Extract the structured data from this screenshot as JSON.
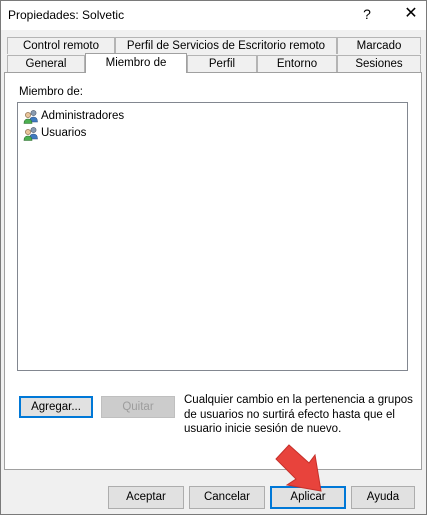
{
  "window": {
    "title": "Propiedades: Solvetic",
    "help_label": "?",
    "close_label": "✕"
  },
  "tabs_top": [
    "Control remoto",
    "Perfil de Servicios de Escritorio remoto",
    "Marcado"
  ],
  "tabs_bottom": [
    "General",
    "Miembro de",
    "Perfil",
    "Entorno",
    "Sesiones"
  ],
  "active_tab": "Miembro de",
  "member": {
    "label": "Miembro de:",
    "items": [
      "Administradores",
      "Usuarios"
    ]
  },
  "actions": {
    "add_label": "Agregar...",
    "remove_label": "Quitar",
    "info": "Cualquier cambio en la pertenencia a grupos de usuarios no surtirá efecto hasta que el usuario inicie sesión de nuevo."
  },
  "footer": {
    "accept_label": "Aceptar",
    "cancel_label": "Cancelar",
    "apply_label": "Aplicar",
    "help_label": "Ayuda"
  },
  "colors": {
    "arrow": "#e8433c",
    "focus": "#0078d7"
  }
}
